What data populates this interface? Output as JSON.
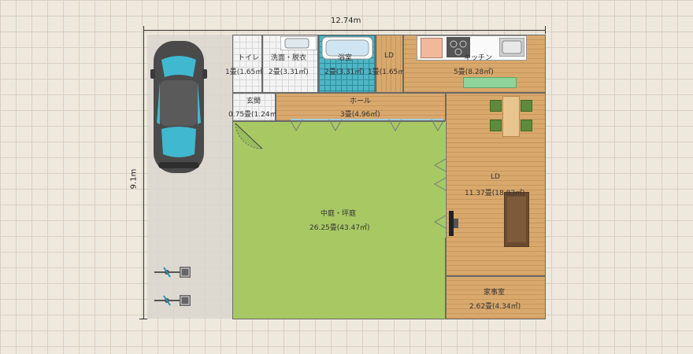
{
  "dimensions": {
    "width": "12.74m",
    "height": "9.1m"
  },
  "rooms": {
    "toilet": {
      "name": "トイレ",
      "area": "1畳(1.65㎡)"
    },
    "washroom": {
      "name": "洗面・脱衣",
      "area": "2畳(3.31㎡)"
    },
    "bath": {
      "name": "浴室",
      "area": "2畳(3.31㎡)"
    },
    "ld_small": {
      "name": "LD",
      "area": "1畳(1.65㎡)"
    },
    "kitchen": {
      "name": "キッチン",
      "area": "5畳(8.28㎡)"
    },
    "entrance": {
      "name": "玄関",
      "area": "0.75畳(1.24㎡)"
    },
    "hall": {
      "name": "ホール",
      "area": "3畳(4.96㎡)"
    },
    "courtyard": {
      "name": "中庭・坪庭",
      "area": "26.25畳(43.47㎡)"
    },
    "ld": {
      "name": "LD",
      "area": "11.37畳(18.83㎡)"
    },
    "utility": {
      "name": "家事室",
      "area": "2.62畳(4.34㎡)"
    }
  },
  "colors": {
    "lawn": "#a8c864",
    "wood": "#d9a86c",
    "car_body": "#4a4a4a",
    "car_glass": "#3fb8d0",
    "parking": "#d9d6cf"
  },
  "icons": [
    "car-icon",
    "bicycle-icon",
    "bathtub-icon",
    "sink-icon",
    "stove-icon",
    "sofa-icon",
    "tv-icon",
    "dining-chair-icon"
  ]
}
